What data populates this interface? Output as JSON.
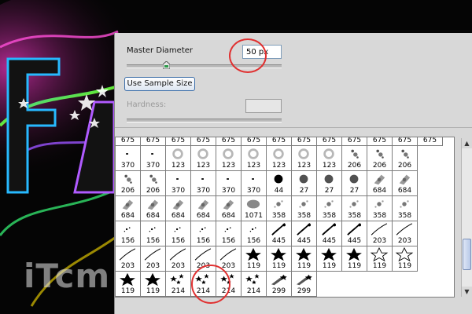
{
  "background": {
    "watermark": "iTcm"
  },
  "panel": {
    "master_diameter_label": "Master Diameter",
    "master_diameter_value": "50 px",
    "use_sample_button": "Use Sample Size",
    "hardness_label": "Hardness:",
    "hardness_value": ""
  },
  "brushes": {
    "partial_top_row": [
      "675",
      "675",
      "675",
      "675",
      "675",
      "675",
      "675",
      "675",
      "675",
      "675",
      "675",
      "675",
      "675"
    ],
    "rows": [
      [
        "370",
        "370",
        "123",
        "123",
        "123",
        "123",
        "123",
        "123",
        "123",
        "206",
        "206",
        "206"
      ],
      [
        "206",
        "206",
        "370",
        "370",
        "370",
        "370",
        "44",
        "27",
        "27",
        "27",
        "684",
        "684"
      ],
      [
        "684",
        "684",
        "684",
        "684",
        "684",
        "1071",
        "358",
        "358",
        "358",
        "358",
        "358",
        "358"
      ],
      [
        "156",
        "156",
        "156",
        "156",
        "156",
        "156",
        "445",
        "445",
        "445",
        "445",
        "203",
        "203"
      ],
      [
        "203",
        "203",
        "203",
        "203",
        "203",
        "119",
        "119",
        "119",
        "119",
        "119",
        "119",
        "119"
      ],
      [
        "119",
        "119",
        "214",
        "214",
        "214",
        "214",
        "299",
        "299"
      ]
    ]
  },
  "accent": {
    "highlight_circle": "#e03030",
    "button_border": "#3d6ea8"
  }
}
